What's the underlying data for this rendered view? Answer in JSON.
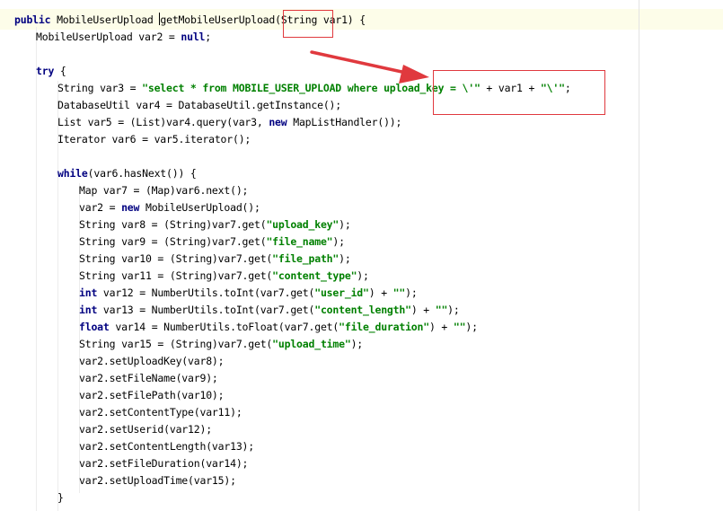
{
  "colors": {
    "keyword": "#000080",
    "string": "#008000",
    "annotation": "#e0393e",
    "current_line": "#fdfde9"
  },
  "code_lines": [
    {
      "indent": 16,
      "tokens": [
        [
          "kw",
          "public"
        ],
        [
          "pl",
          " MobileUserUpload "
        ],
        [
          "caret",
          ""
        ],
        [
          "pl",
          "getMobileUserUpload(String var1) {"
        ]
      ]
    },
    {
      "indent": 40,
      "tokens": [
        [
          "pl",
          "MobileUserUpload var2 = "
        ],
        [
          "kw",
          "null"
        ],
        [
          "pl",
          ";"
        ]
      ]
    },
    {
      "indent": 40,
      "tokens": []
    },
    {
      "indent": 40,
      "tokens": [
        [
          "kw",
          "try"
        ],
        [
          "pl",
          " {"
        ]
      ]
    },
    {
      "indent": 64,
      "tokens": [
        [
          "pl",
          "String var3 = "
        ],
        [
          "str",
          "\"select * from MOBILE_USER_UPLOAD where upload_key = \\'\""
        ],
        [
          "pl",
          " + var1 + "
        ],
        [
          "str",
          "\"\\'\""
        ],
        [
          "pl",
          ";"
        ]
      ]
    },
    {
      "indent": 64,
      "tokens": [
        [
          "pl",
          "DatabaseUtil var4 = DatabaseUtil.getInstance();"
        ]
      ]
    },
    {
      "indent": 64,
      "tokens": [
        [
          "pl",
          "List var5 = (List)var4.query(var3, "
        ],
        [
          "kw",
          "new"
        ],
        [
          "pl",
          " MapListHandler());"
        ]
      ]
    },
    {
      "indent": 64,
      "tokens": [
        [
          "pl",
          "Iterator var6 = var5.iterator();"
        ]
      ]
    },
    {
      "indent": 64,
      "tokens": []
    },
    {
      "indent": 64,
      "tokens": [
        [
          "kw",
          "while"
        ],
        [
          "pl",
          "(var6.hasNext()) {"
        ]
      ]
    },
    {
      "indent": 88,
      "tokens": [
        [
          "pl",
          "Map var7 = (Map)var6.next();"
        ]
      ]
    },
    {
      "indent": 88,
      "tokens": [
        [
          "pl",
          "var2 = "
        ],
        [
          "kw",
          "new"
        ],
        [
          "pl",
          " MobileUserUpload();"
        ]
      ]
    },
    {
      "indent": 88,
      "tokens": [
        [
          "pl",
          "String var8 = (String)var7.get("
        ],
        [
          "str",
          "\"upload_key\""
        ],
        [
          "pl",
          ");"
        ]
      ]
    },
    {
      "indent": 88,
      "tokens": [
        [
          "pl",
          "String var9 = (String)var7.get("
        ],
        [
          "str",
          "\"file_name\""
        ],
        [
          "pl",
          ");"
        ]
      ]
    },
    {
      "indent": 88,
      "tokens": [
        [
          "pl",
          "String var10 = (String)var7.get("
        ],
        [
          "str",
          "\"file_path\""
        ],
        [
          "pl",
          ");"
        ]
      ]
    },
    {
      "indent": 88,
      "tokens": [
        [
          "pl",
          "String var11 = (String)var7.get("
        ],
        [
          "str",
          "\"content_type\""
        ],
        [
          "pl",
          ");"
        ]
      ]
    },
    {
      "indent": 88,
      "tokens": [
        [
          "kw",
          "int"
        ],
        [
          "pl",
          " var12 = NumberUtils.toInt(var7.get("
        ],
        [
          "str",
          "\"user_id\""
        ],
        [
          "pl",
          ") + "
        ],
        [
          "str",
          "\"\""
        ],
        [
          "pl",
          ");"
        ]
      ]
    },
    {
      "indent": 88,
      "tokens": [
        [
          "kw",
          "int"
        ],
        [
          "pl",
          " var13 = NumberUtils.toInt(var7.get("
        ],
        [
          "str",
          "\"content_length\""
        ],
        [
          "pl",
          ") + "
        ],
        [
          "str",
          "\"\""
        ],
        [
          "pl",
          ");"
        ]
      ]
    },
    {
      "indent": 88,
      "tokens": [
        [
          "kw",
          "float"
        ],
        [
          "pl",
          " var14 = NumberUtils.toFloat(var7.get("
        ],
        [
          "str",
          "\"file_duration\""
        ],
        [
          "pl",
          ") + "
        ],
        [
          "str",
          "\"\""
        ],
        [
          "pl",
          ");"
        ]
      ]
    },
    {
      "indent": 88,
      "tokens": [
        [
          "pl",
          "String var15 = (String)var7.get("
        ],
        [
          "str",
          "\"upload_time\""
        ],
        [
          "pl",
          ");"
        ]
      ]
    },
    {
      "indent": 88,
      "tokens": [
        [
          "pl",
          "var2.setUploadKey(var8);"
        ]
      ]
    },
    {
      "indent": 88,
      "tokens": [
        [
          "pl",
          "var2.setFileName(var9);"
        ]
      ]
    },
    {
      "indent": 88,
      "tokens": [
        [
          "pl",
          "var2.setFilePath(var10);"
        ]
      ]
    },
    {
      "indent": 88,
      "tokens": [
        [
          "pl",
          "var2.setContentType(var11);"
        ]
      ]
    },
    {
      "indent": 88,
      "tokens": [
        [
          "pl",
          "var2.setUserid(var12);"
        ]
      ]
    },
    {
      "indent": 88,
      "tokens": [
        [
          "pl",
          "var2.setContentLength(var13);"
        ]
      ]
    },
    {
      "indent": 88,
      "tokens": [
        [
          "pl",
          "var2.setFileDuration(var14);"
        ]
      ]
    },
    {
      "indent": 88,
      "tokens": [
        [
          "pl",
          "var2.setUploadTime(var15);"
        ]
      ]
    },
    {
      "indent": 64,
      "tokens": [
        [
          "pl",
          "}"
        ]
      ]
    }
  ]
}
